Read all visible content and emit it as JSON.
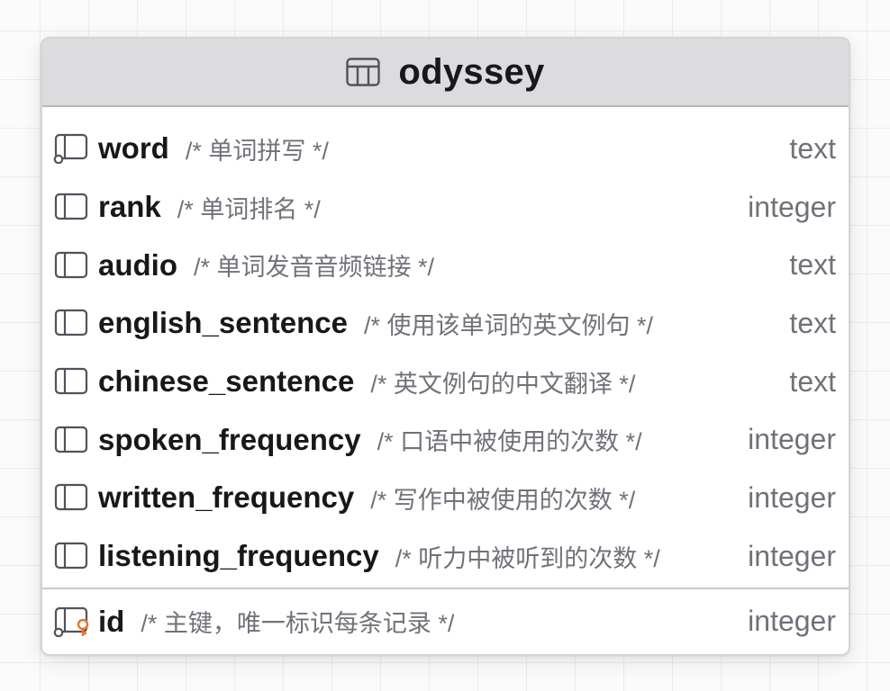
{
  "table": {
    "name": "odyssey",
    "icon": "table-icon"
  },
  "columns": [
    {
      "name": "word",
      "comment": "/* 单词拼写 */",
      "type": "text",
      "icon": "column-unique-icon"
    },
    {
      "name": "rank",
      "comment": "/* 单词排名 */",
      "type": "integer",
      "icon": "column-icon"
    },
    {
      "name": "audio",
      "comment": "/* 单词发音音频链接 */",
      "type": "text",
      "icon": "column-icon"
    },
    {
      "name": "english_sentence",
      "comment": "/* 使用该单词的英文例句 */",
      "type": "text",
      "icon": "column-icon"
    },
    {
      "name": "chinese_sentence",
      "comment": "/* 英文例句的中文翻译 */",
      "type": "text",
      "icon": "column-icon"
    },
    {
      "name": "spoken_frequency",
      "comment": "/* 口语中被使用的次数 */",
      "type": "integer",
      "icon": "column-icon"
    },
    {
      "name": "written_frequency",
      "comment": "/* 写作中被使用的次数 */",
      "type": "integer",
      "icon": "column-icon"
    },
    {
      "name": "listening_frequency",
      "comment": "/* 听力中被听到的次数 */",
      "type": "integer",
      "icon": "column-icon"
    }
  ],
  "primary_key": {
    "name": "id",
    "comment": "/* 主键，唯一标识每条记录 */",
    "type": "integer",
    "icon": "primary-key-column-icon",
    "accent": "#e8742a"
  },
  "colors": {
    "header_bg": "#dcdcde",
    "name_text": "#18181b",
    "muted_text": "#71717a",
    "border": "#d4d4d8"
  }
}
